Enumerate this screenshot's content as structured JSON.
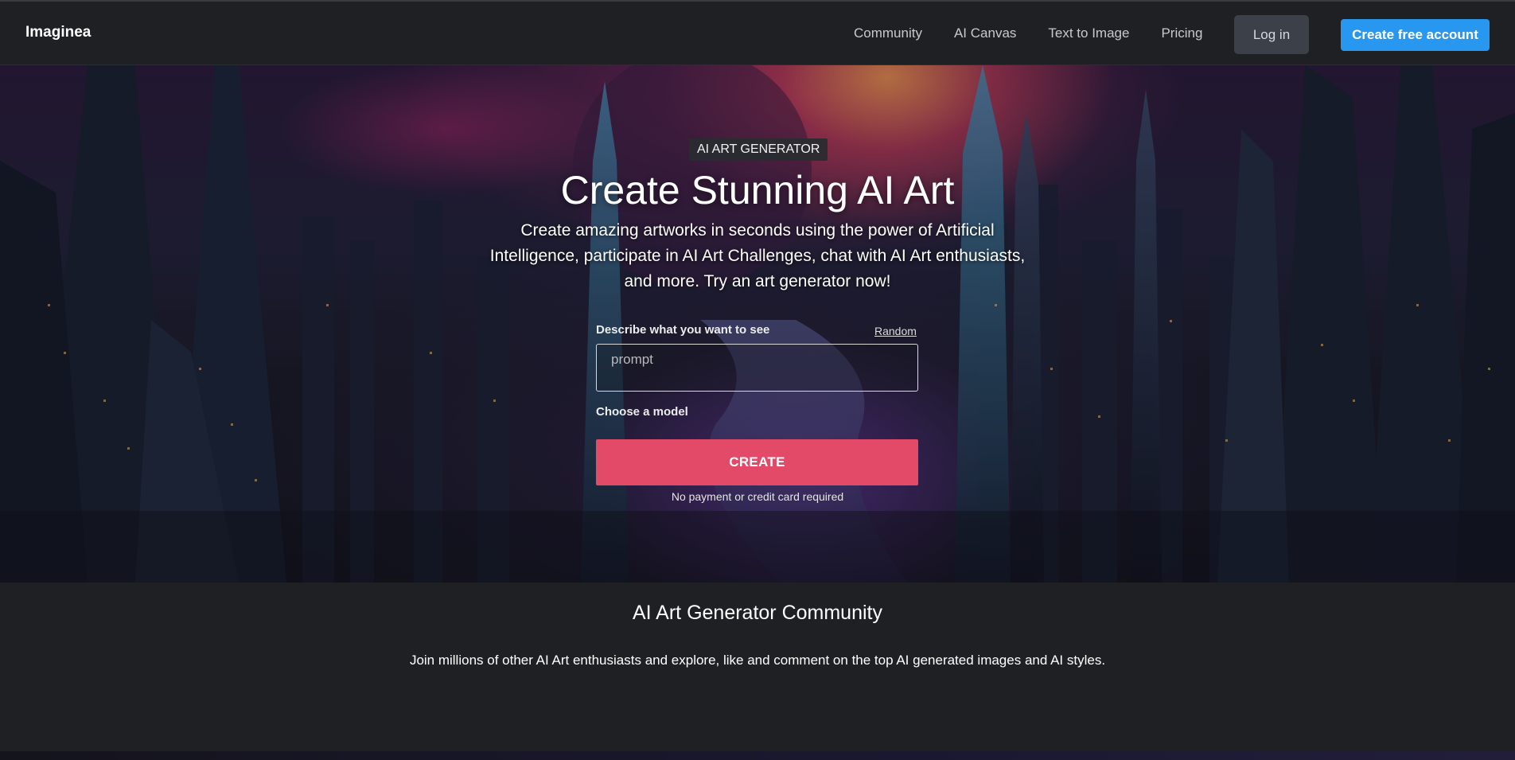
{
  "nav": {
    "brand": "Imaginea",
    "links": [
      "Community",
      "AI Canvas",
      "Text to Image",
      "Pricing"
    ],
    "login_label": "Log in",
    "signup_label": "Create free account"
  },
  "hero": {
    "badge": "AI ART GENERATOR",
    "title": "Create Stunning AI Art",
    "subtitle": "Create amazing artworks in seconds using the power of Artificial Intelligence, participate in AI Art Challenges, chat with AI Art enthusiasts, and more. Try an art generator now!",
    "prompt_label": "Describe what you want to see",
    "random_label": "Random",
    "prompt_placeholder": "prompt",
    "prompt_value": "",
    "model_label": "Choose a model",
    "create_label": "CREATE",
    "no_payment_note": "No payment or credit card required"
  },
  "community": {
    "title": "AI Art Generator Community",
    "subtitle": "Join millions of other AI Art enthusiasts and explore, like and comment on the top AI generated images and AI styles."
  },
  "colors": {
    "background": "#1f2023",
    "accent_blue": "#2797f0",
    "create_pink": "#e34a68",
    "login_gray": "#3c4048"
  }
}
